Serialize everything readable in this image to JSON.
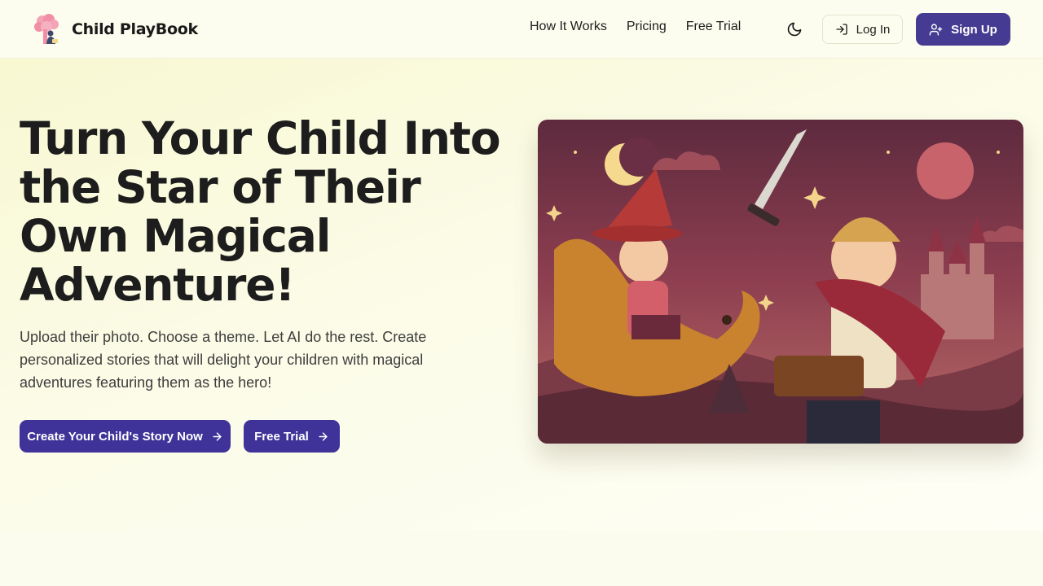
{
  "brand": {
    "name": "Child PlayBook",
    "logo_icon": "tree-child-icon"
  },
  "nav": {
    "items": [
      {
        "label": "How It Works"
      },
      {
        "label": "Pricing"
      },
      {
        "label": "Free Trial"
      }
    ]
  },
  "header": {
    "theme_toggle_icon": "moon-icon",
    "login_label": "Log In",
    "login_icon": "login-icon",
    "signup_label": "Sign Up",
    "signup_icon": "user-plus-icon"
  },
  "hero": {
    "title": "Turn Your Child Into the Star of Their Own Magical Adventure!",
    "subtitle": "Upload their photo. Choose a theme. Let AI do the rest. Create personalized stories that will delight your children with magical adventures featuring them as the hero!",
    "cta_primary": "Create Your Child's Story Now",
    "cta_secondary": "Free Trial",
    "cta_icon": "arrow-right-icon",
    "image": "storybook-illustration"
  },
  "colors": {
    "accent": "#463b92",
    "background": "#fdfdef"
  }
}
